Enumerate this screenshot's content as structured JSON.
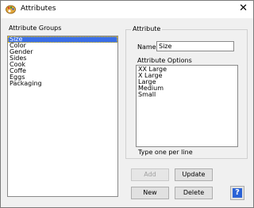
{
  "window": {
    "title": "Attributes"
  },
  "groups": {
    "label": "Attribute Groups",
    "items": [
      "Size",
      "Color",
      "Gender",
      "Sides",
      "Cook",
      "Coffe",
      "Eggs",
      "Packaging"
    ],
    "selected": "Size"
  },
  "attribute": {
    "section_label": "Attribute",
    "name_label": "Name",
    "name_value": "Size",
    "options_label": "Attribute Options",
    "options": [
      "XX Large",
      "X Large",
      "Large",
      "Medium",
      "Small"
    ],
    "hint": "Type one per line"
  },
  "buttons": {
    "add": "Add",
    "update": "Update",
    "new": "New",
    "delete": "Delete",
    "help": "?"
  },
  "colors": {
    "selection": "#3a6ee8",
    "help_icon": "#2a62d6"
  }
}
